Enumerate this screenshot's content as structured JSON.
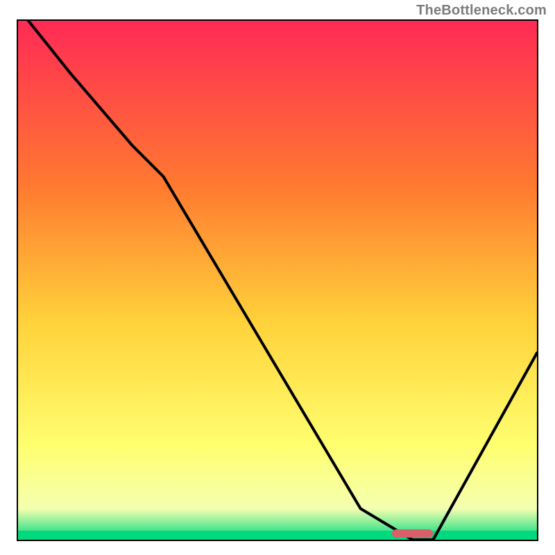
{
  "watermark": "TheBottleneck.com",
  "colors": {
    "gradient_top": "#ff2a55",
    "gradient_mid1": "#ff7a30",
    "gradient_mid2": "#ffd23a",
    "gradient_mid3": "#ffff70",
    "gradient_mid4": "#f4ffb0",
    "gradient_bottom": "#00d97e",
    "curve": "#000000",
    "marker": "#d9606b",
    "border": "#000000"
  },
  "chart_data": {
    "type": "line",
    "title": "",
    "xlabel": "",
    "ylabel": "",
    "xlim": [
      0,
      100
    ],
    "ylim": [
      0,
      100
    ],
    "x": [
      2,
      10,
      22,
      28,
      66,
      76,
      80,
      100
    ],
    "values": [
      100,
      90,
      76,
      70,
      6,
      0,
      0,
      36
    ],
    "optimal_range_x": [
      72,
      80
    ],
    "floor_band_height_pct": 1.8
  }
}
